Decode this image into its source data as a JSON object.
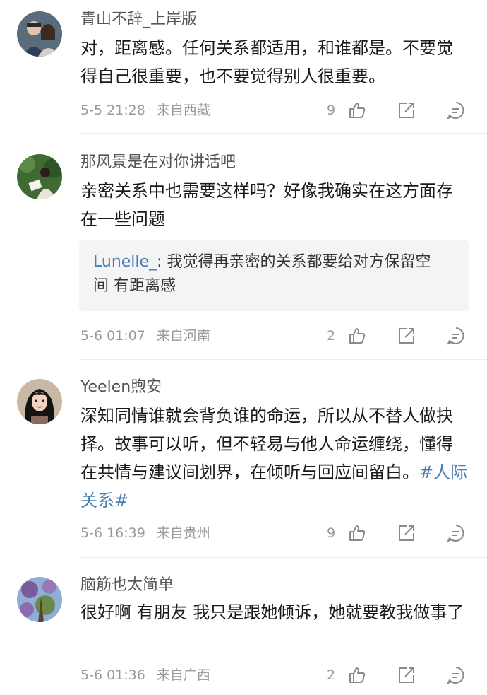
{
  "comments": [
    {
      "username": "青山不辞_上岸版",
      "text": "对，距离感。任何关系都适用，和谁都是。不要觉得自己很重要，也不要觉得别人很重要。",
      "time": "5-5 21:28",
      "location": "来自西藏",
      "likes": "9",
      "avatar_colors": [
        "#3a3f48",
        "#d9b9a0"
      ]
    },
    {
      "username": "那风景是在对你讲话吧",
      "text": "亲密关系中也需要这样吗？好像我确实在这方面存在一些问题",
      "reply": {
        "name": "Lunelle_",
        "text": ": 我觉得再亲密的关系都要给对方保留空间 有距离感"
      },
      "time": "5-6 01:07",
      "location": "来自河南",
      "likes": "2",
      "avatar_colors": [
        "#4b7a3d",
        "#e8e2d8"
      ]
    },
    {
      "username": "Yeelen煦安",
      "text": "深知同情谁就会背负谁的命运，所以从不替人做抉择。故事可以听，但不轻易与他人命运缠绕，懂得在共情与建议间划界，在倾听与回应间留白。",
      "hashtag": "#人际关系#",
      "time": "5-6 16:39",
      "location": "来自贵州",
      "likes": "9",
      "avatar_colors": [
        "#1d1a1a",
        "#f0d2bd"
      ]
    },
    {
      "username": "脑筋也太简单",
      "text": "很好啊 有朋友 我只是跟她倾诉，她就要教我做事了",
      "time": "5-6 01:36",
      "location": "来自广西",
      "likes": "2",
      "avatar_colors": [
        "#6a8fb8",
        "#7a5a9a"
      ]
    }
  ],
  "colors": {
    "text": "#1a1a1a",
    "username": "#555555",
    "meta": "#9a9a9a",
    "link": "#4a7fb5",
    "reply_bg": "#f4f4f5"
  },
  "icons": [
    "thumbs-up-icon",
    "share-icon",
    "comment-icon"
  ]
}
